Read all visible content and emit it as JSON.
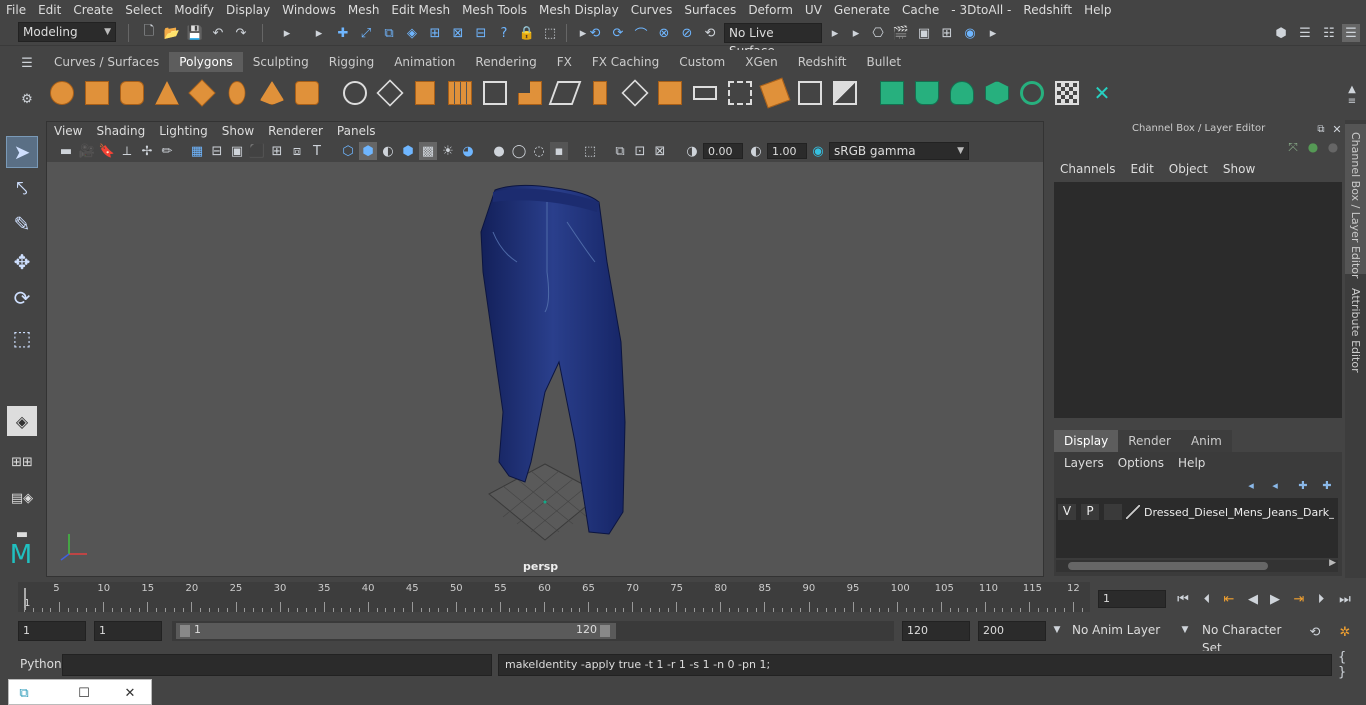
{
  "menus": [
    "File",
    "Edit",
    "Create",
    "Select",
    "Modify",
    "Display",
    "Windows",
    "Mesh",
    "Edit Mesh",
    "Mesh Tools",
    "Mesh Display",
    "Curves",
    "Surfaces",
    "Deform",
    "UV",
    "Generate",
    "Cache",
    "- 3DtoAll -",
    "Redshift",
    "Help"
  ],
  "toolbar": {
    "mode": "Modeling",
    "live_surface": "No Live Surface"
  },
  "shelf_tabs": [
    "Curves / Surfaces",
    "Polygons",
    "Sculpting",
    "Rigging",
    "Animation",
    "Rendering",
    "FX",
    "FX Caching",
    "Custom",
    "XGen",
    "Redshift",
    "Bullet"
  ],
  "shelf_active": "Polygons",
  "viewport": {
    "menus": [
      "View",
      "Shading",
      "Lighting",
      "Show",
      "Renderer",
      "Panels"
    ],
    "exposure": "0.00",
    "gamma": "1.00",
    "colorspace": "sRGB gamma",
    "camera_label": "persp"
  },
  "channel_box": {
    "title": "Channel Box / Layer Editor",
    "menus": [
      "Channels",
      "Edit",
      "Object",
      "Show"
    ]
  },
  "layer_editor": {
    "tabs": [
      "Display",
      "Render",
      "Anim"
    ],
    "active_tab": "Display",
    "menus": [
      "Layers",
      "Options",
      "Help"
    ],
    "layer": {
      "v": "V",
      "p": "P",
      "name": "Dressed_Diesel_Mens_Jeans_Dark_Blue"
    }
  },
  "side_tabs": [
    "Channel Box / Layer Editor",
    "Attribute Editor"
  ],
  "timeline": {
    "ticks": [
      "5",
      "10",
      "15",
      "20",
      "25",
      "30",
      "35",
      "40",
      "45",
      "50",
      "55",
      "60",
      "65",
      "70",
      "75",
      "80",
      "85",
      "90",
      "95",
      "100",
      "105",
      "110",
      "115",
      "12"
    ],
    "start_label": "1",
    "current_frame": "1"
  },
  "range": {
    "start": "1",
    "playback_start": "1",
    "slider_start": "1",
    "slider_end": "120",
    "playback_end": "120",
    "end": "200",
    "anim_layer": "No Anim Layer",
    "character_set": "No Character Set"
  },
  "command": {
    "lang": "Python",
    "output": "makeIdentity -apply true -t 1 -r 1 -s 1 -n 0 -pn 1;"
  }
}
